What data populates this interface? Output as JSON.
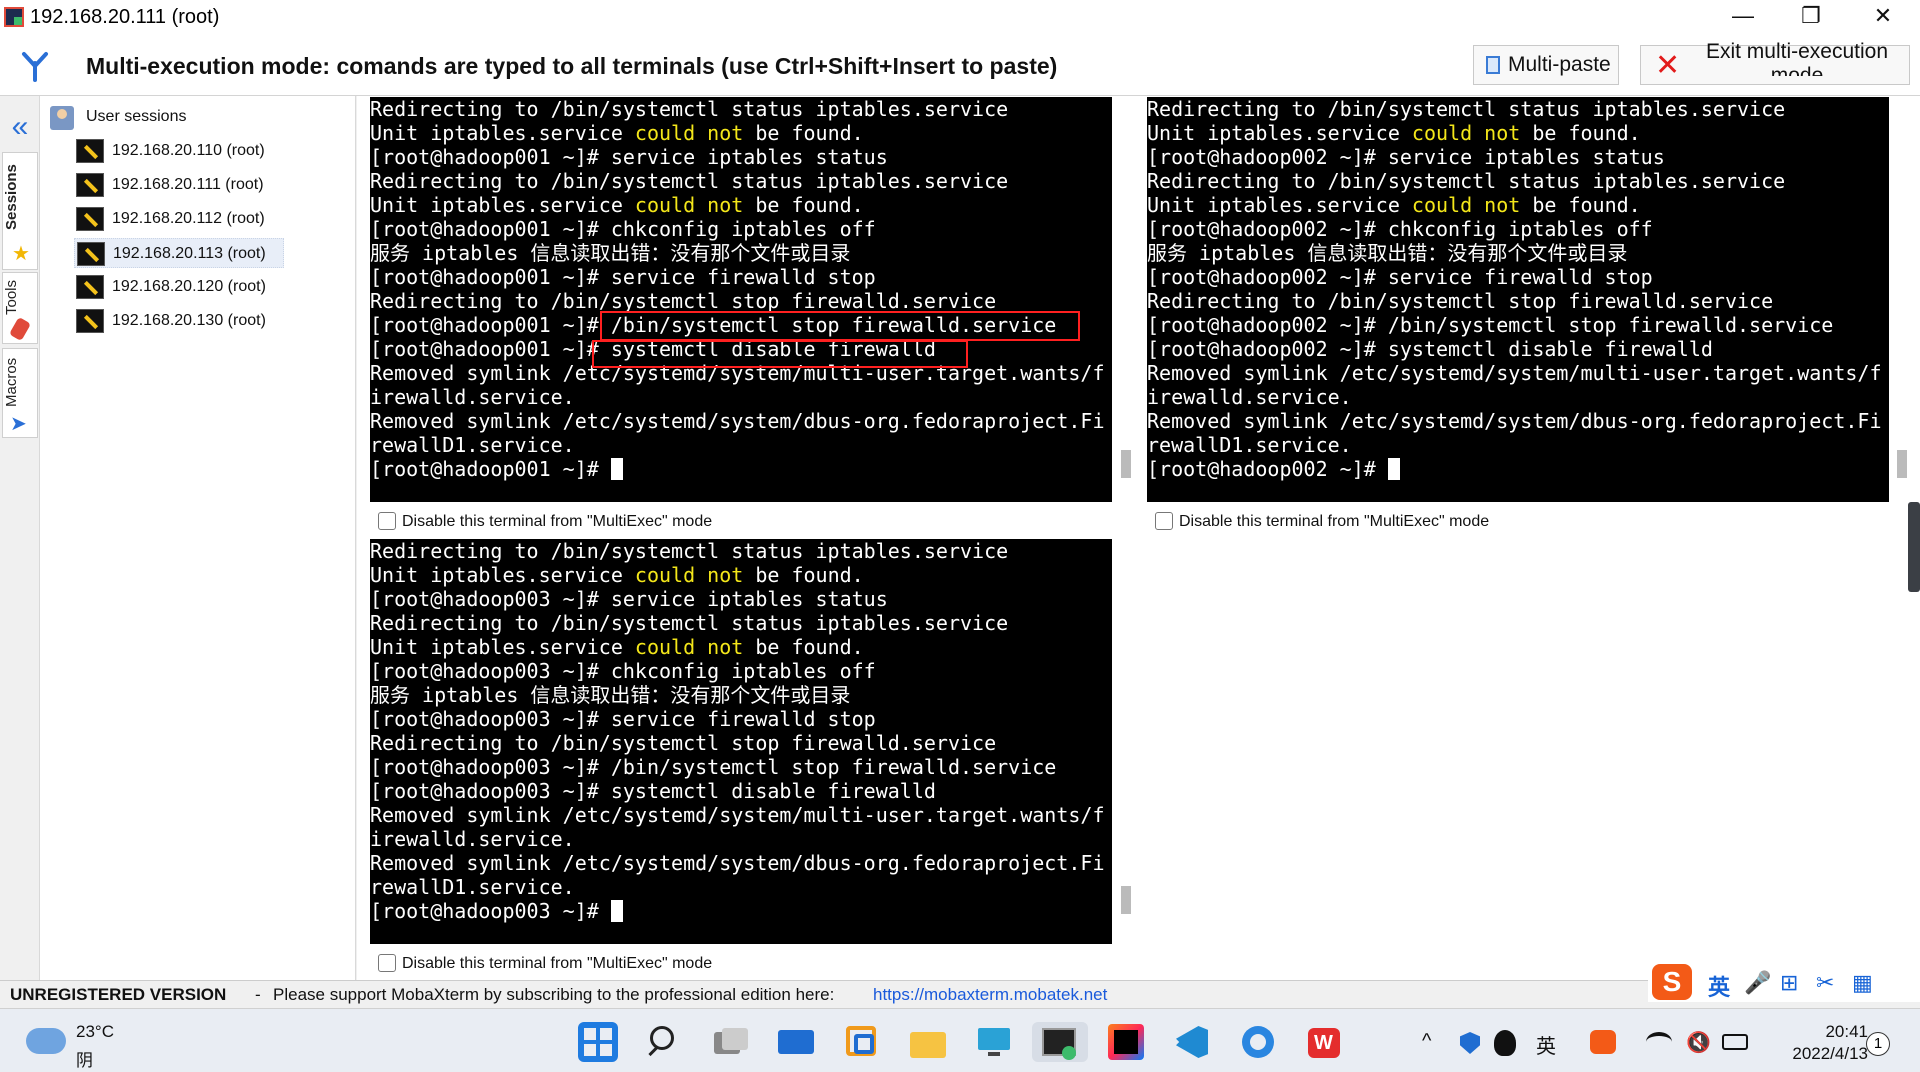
{
  "window": {
    "title": "192.168.20.111 (root)",
    "min": "—",
    "max": "❐",
    "close": "✕"
  },
  "banner": {
    "text": "Multi-execution mode: comands are typed to all terminals (use Ctrl+Shift+Insert to paste)",
    "multipaste": "Multi-paste",
    "exit": "Exit multi-execution mode"
  },
  "sidebar": {
    "tabs": [
      "Sessions",
      "Tools",
      "Macros"
    ],
    "root": "User sessions",
    "sessions": [
      "192.168.20.110 (root)",
      "192.168.20.111 (root)",
      "192.168.20.112 (root)",
      "192.168.20.113 (root)",
      "192.168.20.120 (root)",
      "192.168.20.130 (root)"
    ],
    "selected_index": 3
  },
  "terminals": [
    {
      "host": "hadoop001",
      "lines": [
        "Redirecting to /bin/systemctl status iptables.service",
        "Unit iptables.service |could not| be found.",
        "[root@hadoop001 ~]# service iptables status",
        "Redirecting to /bin/systemctl status iptables.service",
        "Unit iptables.service |could not| be found.",
        "[root@hadoop001 ~]# chkconfig iptables off",
        "服务 iptables 信息读取出错：没有那个文件或目录",
        "[root@hadoop001 ~]# service firewalld stop",
        "Redirecting to /bin/systemctl stop firewalld.service",
        "[root@hadoop001 ~]# /bin/systemctl stop firewalld.service",
        "[root@hadoop001 ~]# systemctl disable firewalld",
        "Removed symlink /etc/systemd/system/multi-user.target.wants/f",
        "irewalld.service.",
        "Removed symlink /etc/systemd/system/dbus-org.fedoraproject.Fi",
        "rewallD1.service.",
        "[root@hadoop001 ~]# "
      ],
      "disable_label": "Disable this terminal from \"MultiExec\" mode"
    },
    {
      "host": "hadoop002",
      "lines": [
        "Redirecting to /bin/systemctl status iptables.service",
        "Unit iptables.service |could not| be found.",
        "[root@hadoop002 ~]# service iptables status",
        "Redirecting to /bin/systemctl status iptables.service",
        "Unit iptables.service |could not| be found.",
        "[root@hadoop002 ~]# chkconfig iptables off",
        "服务 iptables 信息读取出错：没有那个文件或目录",
        "[root@hadoop002 ~]# service firewalld stop",
        "Redirecting to /bin/systemctl stop firewalld.service",
        "[root@hadoop002 ~]# /bin/systemctl stop firewalld.service",
        "[root@hadoop002 ~]# systemctl disable firewalld",
        "Removed symlink /etc/systemd/system/multi-user.target.wants/f",
        "irewalld.service.",
        "Removed symlink /etc/systemd/system/dbus-org.fedoraproject.Fi",
        "rewallD1.service.",
        "[root@hadoop002 ~]# "
      ],
      "disable_label": "Disable this terminal from \"MultiExec\" mode"
    },
    {
      "host": "hadoop003",
      "lines": [
        "Redirecting to /bin/systemctl status iptables.service",
        "Unit iptables.service |could not| be found.",
        "[root@hadoop003 ~]# service iptables status",
        "Redirecting to /bin/systemctl status iptables.service",
        "Unit iptables.service |could not| be found.",
        "[root@hadoop003 ~]# chkconfig iptables off",
        "服务 iptables 信息读取出错：没有那个文件或目录",
        "[root@hadoop003 ~]# service firewalld stop",
        "Redirecting to /bin/systemctl stop firewalld.service",
        "[root@hadoop003 ~]# /bin/systemctl stop firewalld.service",
        "[root@hadoop003 ~]# systemctl disable firewalld",
        "Removed symlink /etc/systemd/system/multi-user.target.wants/f",
        "irewalld.service.",
        "Removed symlink /etc/systemd/system/dbus-org.fedoraproject.Fi",
        "rewallD1.service.",
        "[root@hadoop003 ~]# "
      ],
      "disable_label": "Disable this terminal from \"MultiExec\" mode"
    }
  ],
  "status": {
    "unregistered": "UNREGISTERED VERSION",
    "sep": "-",
    "message": "Please support MobaXterm by subscribing to the professional edition here:",
    "url": "https://mobaxterm.mobatek.net"
  },
  "ime": {
    "logo": "S",
    "items": [
      "英",
      "🎤",
      "⊞",
      "✂",
      "▦"
    ]
  },
  "taskbar": {
    "weather_temp": "23°C",
    "weather_desc": "阴",
    "apps": [
      "start-icon",
      "search-icon",
      "task-view-icon",
      "mail-icon",
      "vm-icon",
      "file-explorer-icon",
      "remote-desktop-icon",
      "mobaxterm-icon",
      "intellij-icon",
      "vscode-icon",
      "browser-icon",
      "wps-icon"
    ],
    "tray": {
      "chevron": "^",
      "lang": "英",
      "time": "20:41",
      "date": "2022/4/13",
      "notifications": "1"
    }
  },
  "colors": {
    "accent": "#2a6fd6",
    "highlight": "#ff2020",
    "terminal_bg": "#000000",
    "terminal_yellow": "#f4e71a"
  }
}
